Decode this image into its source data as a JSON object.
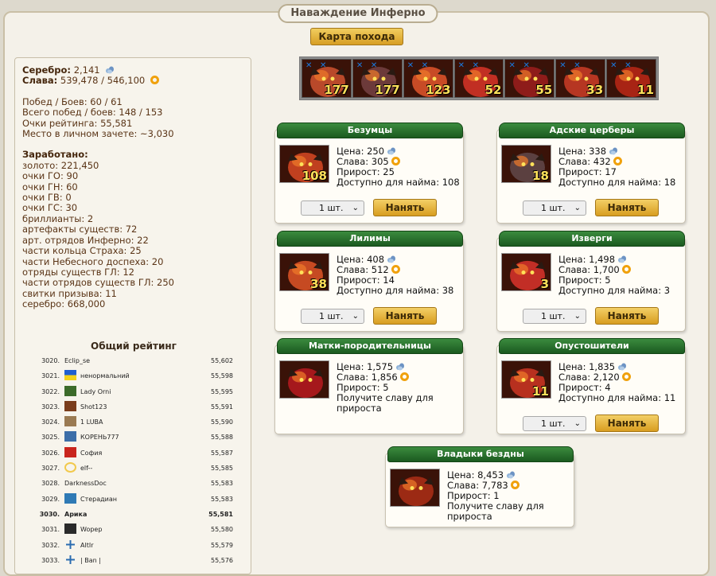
{
  "window": {
    "title": "Наваждение Инферно"
  },
  "map_button": "Карта похода",
  "stats": {
    "silver_label": "Серебро:",
    "silver_value": "2,141",
    "glory_label": "Слава:",
    "glory_value": "539,478 / 546,100",
    "wins": "Побед / Боев: 60 / 61",
    "total_wins": "Всего побед / боев: 148 / 153",
    "rating_points": "Очки рейтинга: 55,581",
    "place": "Место в личном зачете: ~3,030",
    "earned_label": "Заработано:",
    "earned": [
      "золото: 221,450",
      "очки ГО: 90",
      "очки ГН: 60",
      "очки ГВ: 0",
      "очки ГС: 30",
      "бриллианты: 2",
      "артефакты существ: 72",
      "арт. отрядов Инферно: 22",
      "части кольца Страха: 25",
      "части Небесного доспеха: 20",
      "отряды существ ГЛ: 12",
      "части отрядов существ ГЛ: 250",
      "свитки призыва: 11",
      "серебро: 668,000"
    ]
  },
  "rating": {
    "title": "Общий рейтинг",
    "rows": [
      {
        "num": "3020.",
        "name": "Eclip_se",
        "score": "55,602",
        "avatar": ""
      },
      {
        "num": "3021.",
        "name": "ненормальний",
        "score": "55,598",
        "avatar": "flag-ukraine-icon"
      },
      {
        "num": "3022.",
        "name": "Lady Orni",
        "score": "55,595",
        "avatar": "warrior-portrait-icon"
      },
      {
        "num": "3023.",
        "name": "Shot123",
        "score": "55,591",
        "avatar": "beast-icon"
      },
      {
        "num": "3024.",
        "name": "1 LUBA",
        "score": "55,590",
        "avatar": "wings-icon"
      },
      {
        "num": "3025.",
        "name": "КОРЕНЬ777",
        "score": "55,588",
        "avatar": "clan-crest-icon"
      },
      {
        "num": "3026.",
        "name": "София",
        "score": "55,587",
        "avatar": "letter-m-icon"
      },
      {
        "num": "3027.",
        "name": "elf--",
        "score": "55,585",
        "avatar": "moon-icon"
      },
      {
        "num": "3028.",
        "name": "DarknessDoc",
        "score": "55,583",
        "avatar": ""
      },
      {
        "num": "3029.",
        "name": "Стерадиан",
        "score": "55,583",
        "avatar": "letter-h-icon"
      },
      {
        "num": "3030.",
        "name": "Арика",
        "score": "55,581",
        "avatar": ""
      },
      {
        "num": "3031.",
        "name": "Wopep",
        "score": "55,580",
        "avatar": "wolf-icon"
      },
      {
        "num": "3032.",
        "name": "AltIr",
        "score": "55,579",
        "avatar": "cross-icon"
      },
      {
        "num": "3033.",
        "name": "| Ban |",
        "score": "55,576",
        "avatar": "cross-icon"
      }
    ]
  },
  "army": [
    {
      "count": "177",
      "color": "#b9492a"
    },
    {
      "count": "177",
      "color": "#6c3a3a"
    },
    {
      "count": "123",
      "color": "#c84b26"
    },
    {
      "count": "52",
      "color": "#c12f23"
    },
    {
      "count": "55",
      "color": "#8e1c1a"
    },
    {
      "count": "33",
      "color": "#b63622"
    },
    {
      "count": "11",
      "color": "#a82414"
    }
  ],
  "units": [
    {
      "title": "Безумцы",
      "price": "Цена: 250",
      "glory": "Слава: 305",
      "growth": "Прирост: 25",
      "available": "Доступно для найма: 108",
      "count": "108",
      "qty": "1 шт.",
      "hire": "Нанять",
      "color": "#c0401f"
    },
    {
      "title": "Адские церберы",
      "price": "Цена: 338",
      "glory": "Слава: 432",
      "growth": "Прирост: 17",
      "available": "Доступно для найма: 18",
      "count": "18",
      "qty": "1 шт.",
      "hire": "Нанять",
      "color": "#5b4040"
    },
    {
      "title": "Лилимы",
      "price": "Цена: 408",
      "glory": "Слава: 512",
      "growth": "Прирост: 14",
      "available": "Доступно для найма: 38",
      "count": "38",
      "qty": "1 шт.",
      "hire": "Нанять",
      "color": "#c64a22"
    },
    {
      "title": "Изверги",
      "price": "Цена: 1,498",
      "glory": "Слава: 1,700",
      "growth": "Прирост: 5",
      "available": "Доступно для найма: 3",
      "count": "3",
      "qty": "1 шт.",
      "hire": "Нанять",
      "color": "#c22e26"
    },
    {
      "title": "Матки-породительницы",
      "price": "Цена: 1,575",
      "glory": "Слава: 1,856",
      "growth": "Прирост: 5",
      "available": "Получите славу для прироста",
      "count": "",
      "qty": "",
      "hire": "",
      "color": "#a5181c"
    },
    {
      "title": "Опустошители",
      "price": "Цена: 1,835",
      "glory": "Слава: 2,120",
      "growth": "Прирост: 4",
      "available": "Доступно для найма: 11",
      "count": "11",
      "qty": "1 шт.",
      "hire": "Нанять",
      "color": "#b7301f"
    },
    {
      "title": "Владыки бездны",
      "price": "Цена: 8,453",
      "glory": "Слава: 7,783",
      "growth": "Прирост: 1",
      "available": "Получите славу для прироста",
      "count": "",
      "qty": "",
      "hire": "",
      "color": "#9c2a14"
    }
  ]
}
